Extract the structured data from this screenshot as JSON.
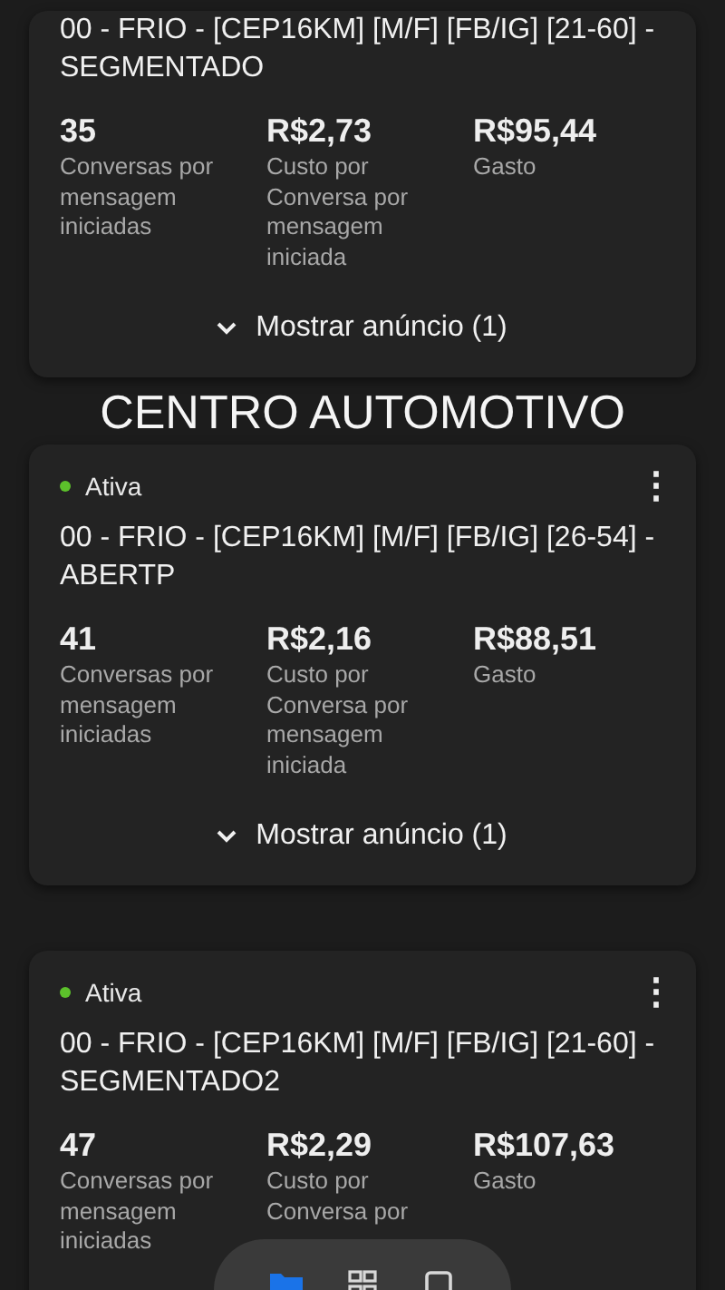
{
  "feed": [
    {
      "kind": "card",
      "title": "00 - FRIO - [CEP16KM] [M/F] [FB/IG] [21-60] -SEGMENTADO",
      "metrics": [
        {
          "value": "35",
          "label": "Conversas por mensagem iniciadas"
        },
        {
          "value": "R$2,73",
          "label": "Custo por Conversa por mensagem iniciada"
        },
        {
          "value": "R$95,44",
          "label": "Gasto"
        }
      ],
      "show_more": "Mostrar anúncio (1)"
    },
    {
      "kind": "heading",
      "text": "CENTRO AUTOMOTIVO"
    },
    {
      "kind": "card",
      "status": {
        "label": "Ativa",
        "color": "#5cc12b"
      },
      "menu": "⋮",
      "title": "00 - FRIO - [CEP16KM] [M/F] [FB/IG] [26-54] -ABERTP",
      "metrics": [
        {
          "value": "41",
          "label": "Conversas por mensagem iniciadas"
        },
        {
          "value": "R$2,16",
          "label": "Custo por Conversa por mensagem iniciada"
        },
        {
          "value": "R$88,51",
          "label": "Gasto"
        }
      ],
      "show_more": "Mostrar anúncio (1)"
    },
    {
      "kind": "card",
      "status": {
        "label": "Ativa",
        "color": "#5cc12b"
      },
      "menu": "⋮",
      "title": "00 - FRIO - [CEP16KM] [M/F] [FB/IG] [21-60] -SEGMENTADO2",
      "metrics": [
        {
          "value": "47",
          "label": "Conversas por mensagem iniciadas"
        },
        {
          "value": "R$2,29",
          "label": "Custo por Conversa por"
        },
        {
          "value": "R$107,63",
          "label": "Gasto"
        }
      ]
    }
  ],
  "bottom_nav": [
    {
      "kind": "folder",
      "selected": true
    },
    {
      "kind": "grid",
      "selected": false
    },
    {
      "kind": "square",
      "selected": false
    }
  ]
}
